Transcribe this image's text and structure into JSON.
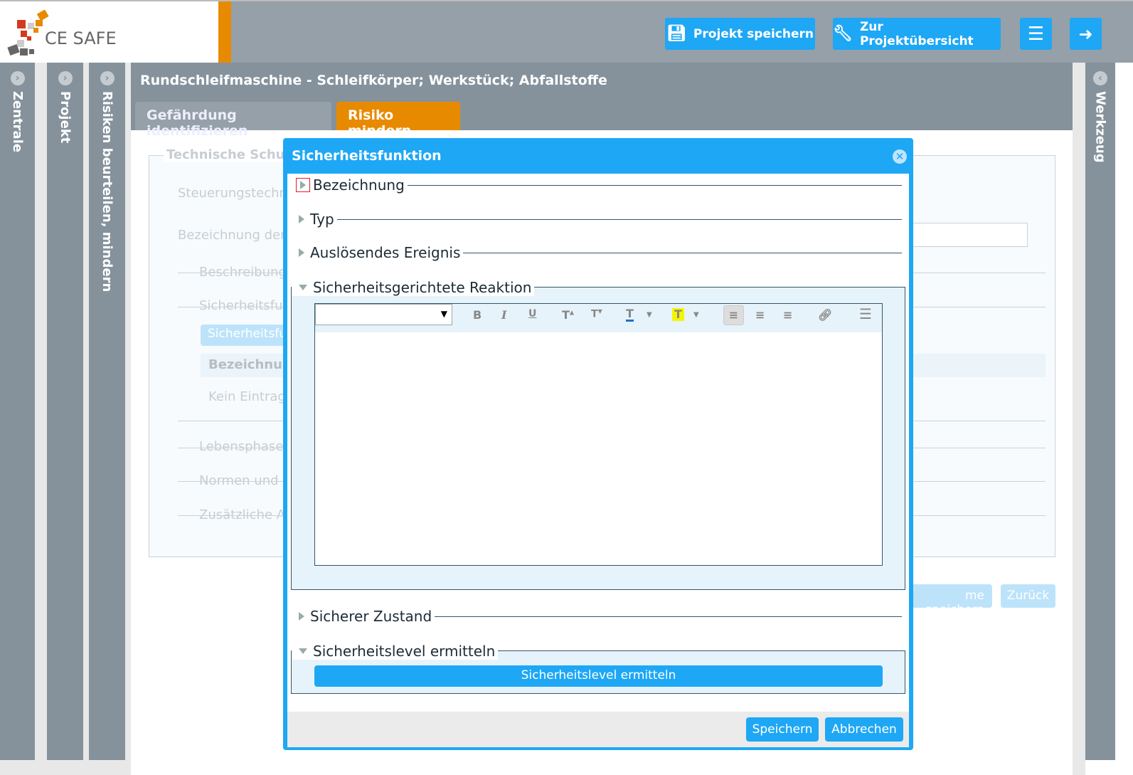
{
  "app": {
    "logo_text": "CE SAFE"
  },
  "header": {
    "save_project": "Projekt speichern",
    "project_overview": "Zur Projektübersicht",
    "menu_icon": "hamburger-icon",
    "logout_icon": "logout-icon"
  },
  "sidebars": {
    "left": [
      "Zentrale",
      "Projekt",
      "Risiken beurteilen, mindern"
    ],
    "right": "Werkzeug"
  },
  "page": {
    "title": "Rundschleifmaschine - Schleifkörper; Werkstück; Abfallstoffe",
    "tabs": [
      {
        "label": "Gefährdung identifizieren",
        "active": false
      },
      {
        "label": "Risiko mindern",
        "active": true
      }
    ]
  },
  "background_form": {
    "legend": "Technische Schu",
    "fields": [
      "Steuerungstechn",
      "Bezeichnung der"
    ],
    "sections": [
      "Beschreibung",
      "Sicherheitsfu",
      "Lebensphase",
      "Normen und",
      "Zusätzliche A"
    ],
    "add_button": "Sicherheitsfur",
    "table_header": "Bezeichnur",
    "empty_text": "Kein Eintrag",
    "save_button": "me speichern",
    "back_button": "Zurück"
  },
  "modal": {
    "title": "Sicherheitsfunktion",
    "sections": {
      "bezeichnung": "Bezeichnung",
      "typ": "Typ",
      "ausloesendes": "Auslösendes Ereignis",
      "reaktion": "Sicherheitsgerichtete Reaktion",
      "zustand": "Sicherer Zustand",
      "level": "Sicherheitslevel ermitteln"
    },
    "editor": {
      "format_select": "",
      "toolbar": [
        "bold",
        "italic",
        "underline",
        "superscript",
        "subscript",
        "text-color",
        "highlight",
        "align-left",
        "align-center",
        "align-right",
        "link",
        "list"
      ]
    },
    "level_button": "Sicherheitslevel ermitteln",
    "save": "Speichern",
    "cancel": "Abbrechen"
  },
  "colors": {
    "accent": "#1ea7f5",
    "orange": "#e88a00",
    "sidebar": "#85929b"
  }
}
